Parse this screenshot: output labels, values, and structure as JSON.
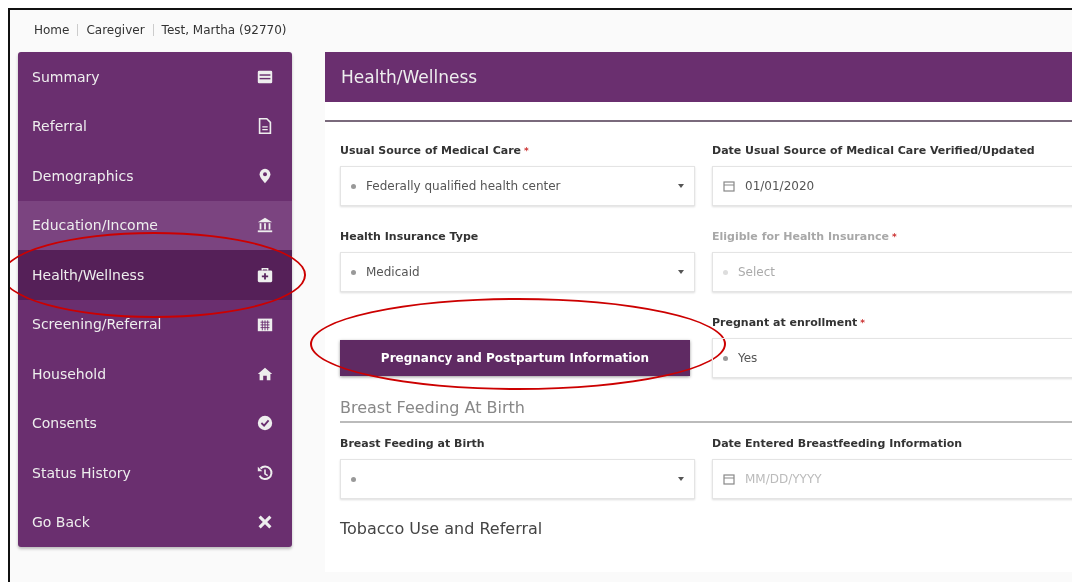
{
  "breadcrumb": [
    {
      "label": "Home"
    },
    {
      "label": "Caregiver"
    },
    {
      "label": "Test, Martha (92770)"
    }
  ],
  "sidebar": {
    "items": [
      {
        "label": "Summary",
        "selected": false,
        "hover": false,
        "circled": false
      },
      {
        "label": "Referral",
        "selected": false,
        "hover": false,
        "circled": false
      },
      {
        "label": "Demographics",
        "selected": false,
        "hover": false,
        "circled": false
      },
      {
        "label": "Education/Income",
        "selected": false,
        "hover": true,
        "circled": false
      },
      {
        "label": "Health/Wellness",
        "selected": true,
        "hover": false,
        "circled": true
      },
      {
        "label": "Screening/Referral",
        "selected": false,
        "hover": false,
        "circled": false
      },
      {
        "label": "Household",
        "selected": false,
        "hover": false,
        "circled": false
      },
      {
        "label": "Consents",
        "selected": false,
        "hover": false,
        "circled": false
      },
      {
        "label": "Status History",
        "selected": false,
        "hover": false,
        "circled": false
      },
      {
        "label": "Go Back",
        "selected": false,
        "hover": false,
        "circled": false
      }
    ]
  },
  "panel": {
    "title": "Health/Wellness",
    "rows": [
      [
        {
          "kind": "select",
          "label": "Usual Source of Medical Care",
          "required_mark": "*",
          "value": "Federally qualified health center",
          "disabled": false
        },
        {
          "kind": "date",
          "label": "Date Usual Source of Medical Care Verified/Updated",
          "value": "01/01/2020",
          "disabled": false
        }
      ],
      [
        {
          "kind": "select",
          "label": "Health Insurance Type",
          "value": "Medicaid",
          "disabled": false
        },
        {
          "kind": "select",
          "label": "Eligible for Health Insurance",
          "required_mark": "*",
          "placeholder": "Select",
          "disabled": true
        }
      ],
      [
        {
          "kind": "button",
          "label": "Pregnancy and Postpartum Information",
          "circled": true
        },
        {
          "kind": "select",
          "label": "Pregnant at enrollment",
          "required_mark": "*",
          "value": "Yes",
          "disabled": false
        }
      ]
    ],
    "sections": [
      {
        "title": "Breast Feeding At Birth",
        "rows": [
          [
            {
              "kind": "select",
              "label": "Breast Feeding at Birth",
              "disabled": false
            },
            {
              "kind": "date",
              "label": "Date Entered Breastfeeding Information",
              "placeholder": "MM/DD/YYYY",
              "disabled": false
            }
          ]
        ]
      },
      {
        "title": "Tobacco Use and Referral"
      }
    ]
  }
}
